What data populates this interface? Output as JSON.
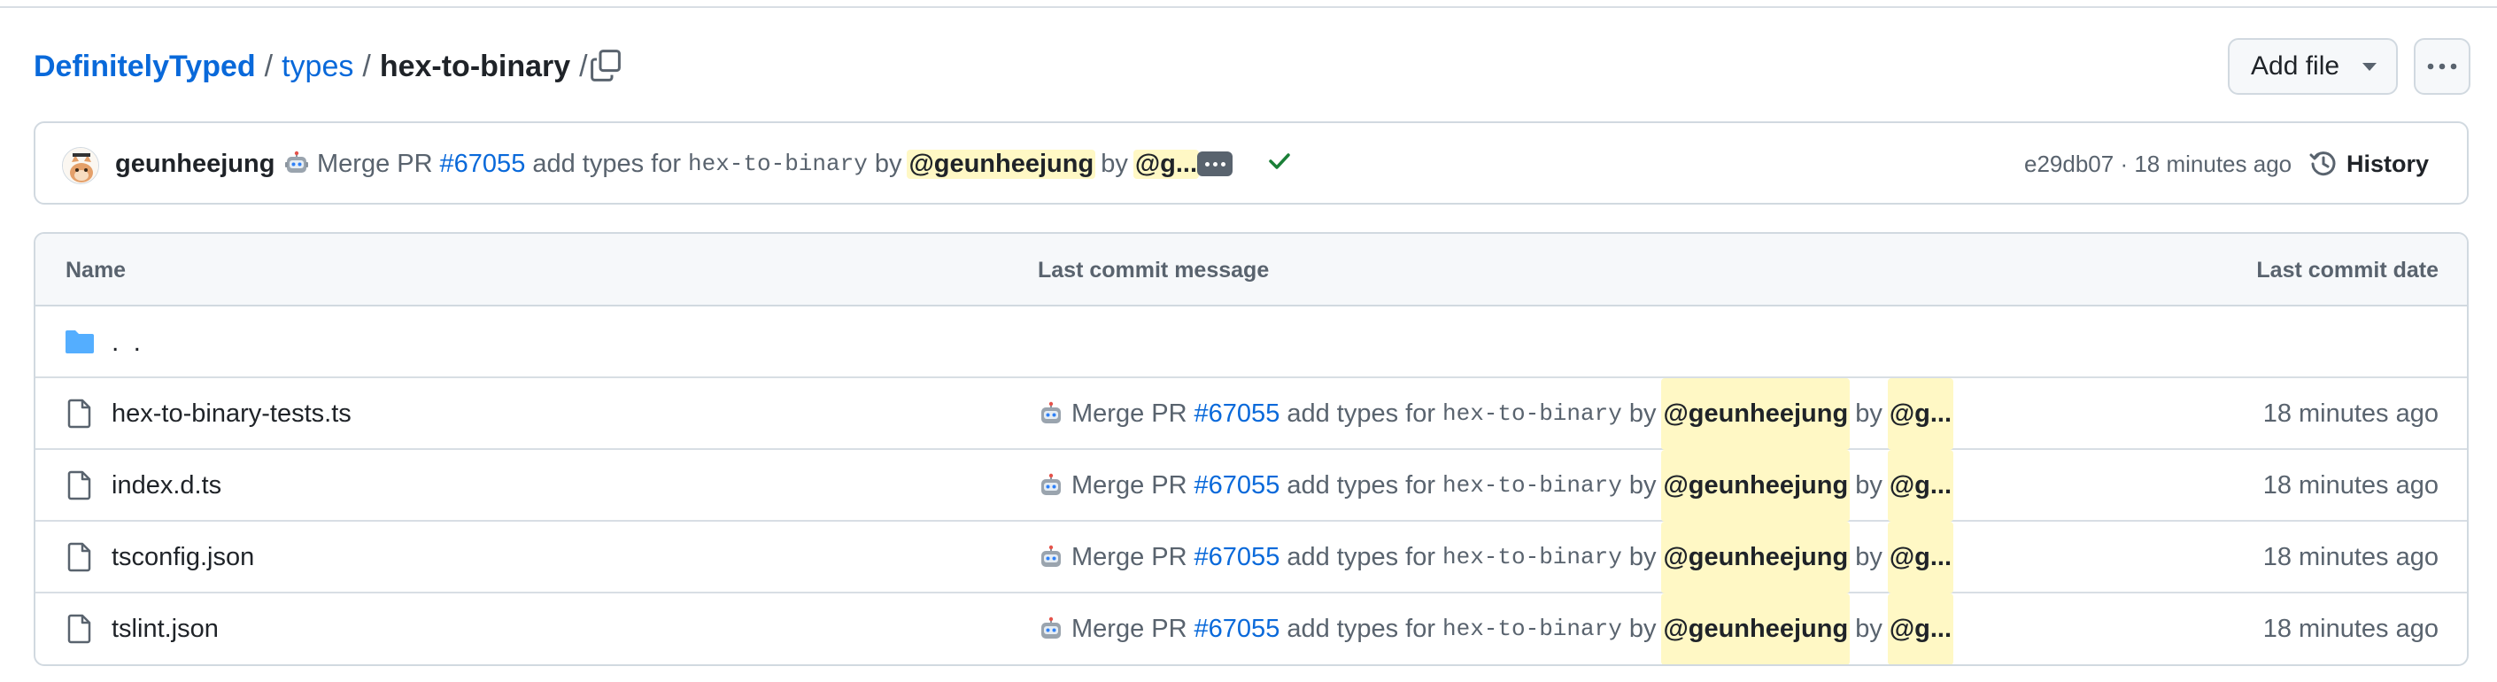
{
  "breadcrumb": {
    "repo": "DefinitelyTyped",
    "folder": "types",
    "current": "hex-to-binary",
    "separator": "/",
    "trailing_separator": "/"
  },
  "actions": {
    "add_file_label": "Add file",
    "more_icon": "kebab-horizontal-icon"
  },
  "commit": {
    "author": "geunheejung",
    "prefix": "Merge PR",
    "pr_number": "#67055",
    "mid_text": "add types for",
    "package": "hex-to-binary",
    "by1": "by",
    "mention1": "@geunheejung",
    "by2": "by",
    "mention2": "@g...",
    "sha_and_time": "e29db07 · 18 minutes ago",
    "history_label": "History",
    "status": "success"
  },
  "table": {
    "headers": {
      "name": "Name",
      "message": "Last commit message",
      "date": "Last commit date"
    },
    "parent_label": ". .",
    "files": [
      {
        "name": "hex-to-binary-tests.ts",
        "msg": {
          "prefix": "Merge PR",
          "pr": "#67055",
          "mid": "add types for",
          "pkg": "hex-to-binary",
          "by1": "by",
          "mention1": "@geunheejung",
          "by2": "by",
          "mention2": "@g..."
        },
        "date": "18 minutes ago"
      },
      {
        "name": "index.d.ts",
        "msg": {
          "prefix": "Merge PR",
          "pr": "#67055",
          "mid": "add types for",
          "pkg": "hex-to-binary",
          "by1": "by",
          "mention1": "@geunheejung",
          "by2": "by",
          "mention2": "@g..."
        },
        "date": "18 minutes ago"
      },
      {
        "name": "tsconfig.json",
        "msg": {
          "prefix": "Merge PR",
          "pr": "#67055",
          "mid": "add types for",
          "pkg": "hex-to-binary",
          "by1": "by",
          "mention1": "@geunheejung",
          "by2": "by",
          "mention2": "@g..."
        },
        "date": "18 minutes ago"
      },
      {
        "name": "tslint.json",
        "msg": {
          "prefix": "Merge PR",
          "pr": "#67055",
          "mid": "add types for",
          "pkg": "hex-to-binary",
          "by1": "by",
          "mention1": "@geunheejung",
          "by2": "by",
          "mention2": "@g..."
        },
        "date": "18 minutes ago"
      }
    ]
  },
  "colors": {
    "link": "#0969da",
    "muted": "#59636e",
    "mention_bg": "#fff8c5",
    "success": "#1a7f37",
    "folder": "#54aeff"
  }
}
